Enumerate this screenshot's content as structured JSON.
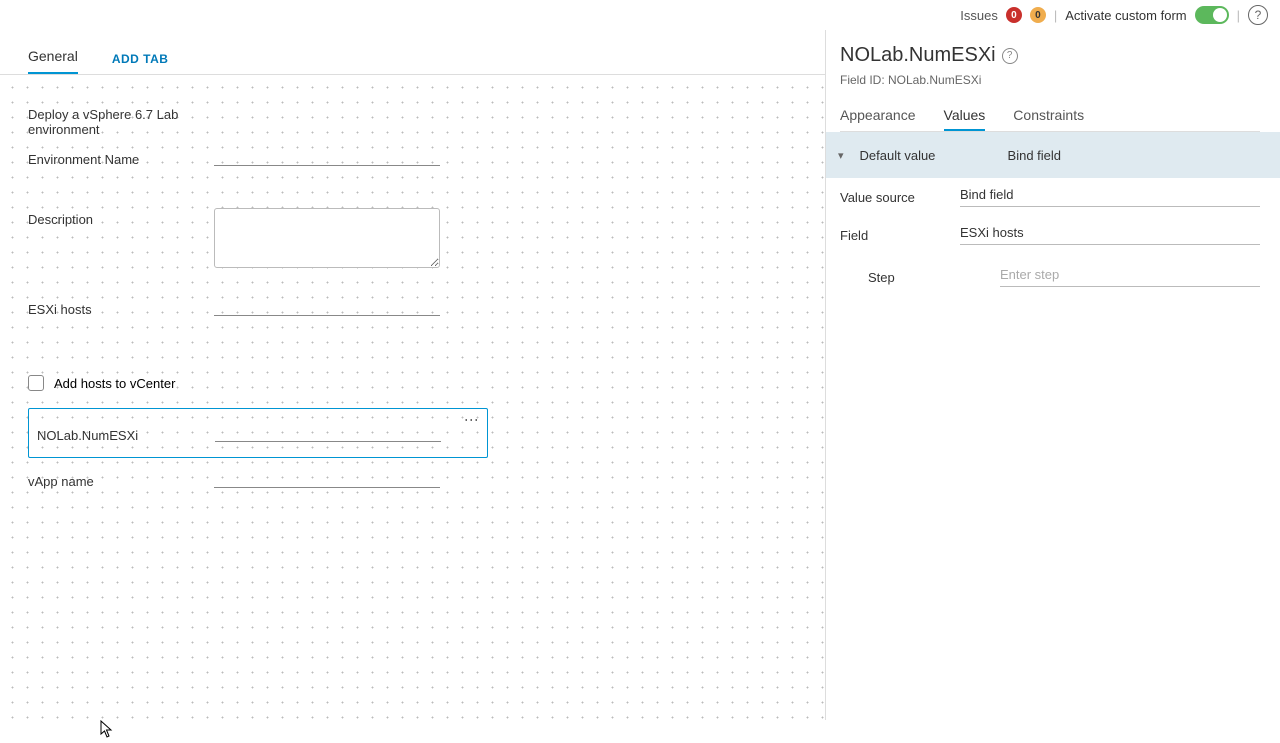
{
  "topbar": {
    "issues_label": "Issues",
    "badge_red": "0",
    "badge_yellow": "0",
    "activate_label": "Activate custom form"
  },
  "tabs": {
    "general": "General",
    "add_tab": "ADD TAB"
  },
  "form": {
    "title": "Deploy a vSphere 6.7 Lab environment",
    "env_name_label": "Environment Name",
    "description_label": "Description",
    "esxi_label": "ESXi hosts",
    "add_hosts_label": "Add hosts to vCenter",
    "selected_label": "NOLab.NumESXi",
    "vapp_label": "vApp name"
  },
  "side": {
    "title": "NOLab.NumESXi",
    "field_id": "Field ID: NOLab.NumESXi",
    "tabs": {
      "appearance": "Appearance",
      "values": "Values",
      "constraints": "Constraints"
    },
    "section_label": "Default value",
    "section_value": "Bind field",
    "value_source_key": "Value source",
    "value_source_val": "Bind field",
    "field_key": "Field",
    "field_val": "ESXi hosts",
    "step_key": "Step",
    "step_placeholder": "Enter step"
  }
}
